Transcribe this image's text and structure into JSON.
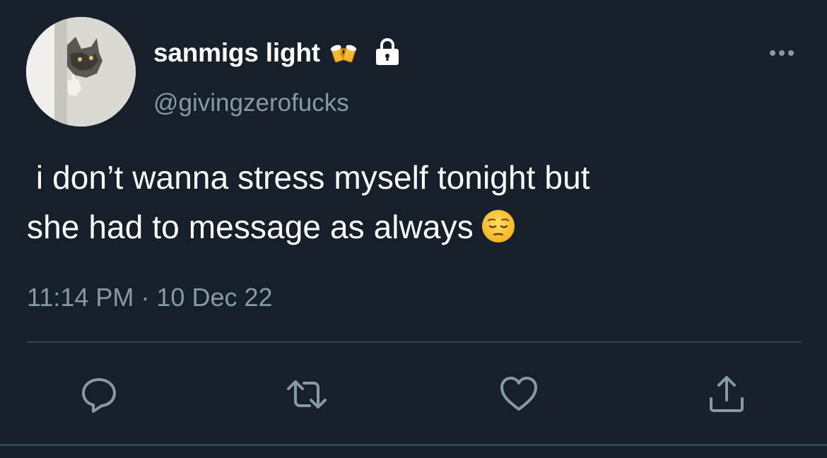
{
  "tweet": {
    "display_name": "sanmigs light",
    "handle": "@givingzerofucks",
    "text_line1": " i don’t wanna stress myself tonight but",
    "text_line2": "she had to message as always",
    "timestamp": "11:14 PM · 10 Dec 22"
  },
  "icons": {
    "name_emoji": "clinking-beer-mugs-icon",
    "protected": "lock-icon",
    "more": "more-icon",
    "text_emoji": "pensive-face-icon",
    "actions": [
      "reply-icon",
      "retweet-icon",
      "like-icon",
      "share-icon"
    ]
  },
  "colors": {
    "background": "#15202b",
    "primary_text": "#ffffff",
    "secondary_text": "#8899a6",
    "divider": "#38444d"
  }
}
